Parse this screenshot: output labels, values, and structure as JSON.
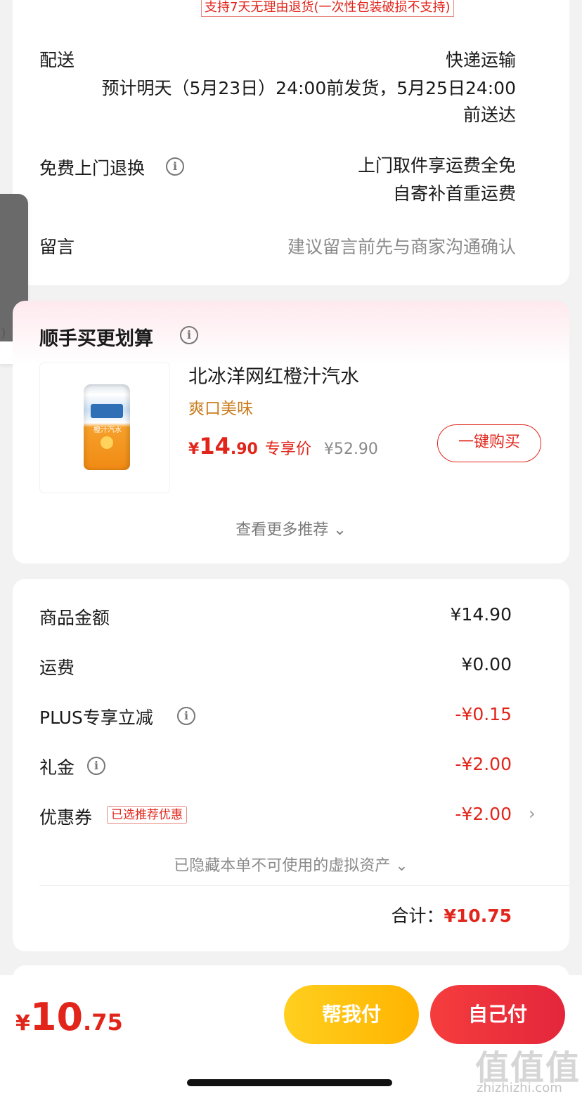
{
  "notice": {
    "text": "支持7天无理由退货(一次性包装破损不支持)"
  },
  "delivery": {
    "label": "配送",
    "method": "快递运输",
    "eta_line1": "预计明天（5月23日）24:00前发货，5月25日24:00",
    "eta_line2": "前送达"
  },
  "returns": {
    "label": "免费上门退换",
    "value_line1": "上门取件享运费全免",
    "value_line2": "自寄补首重运费"
  },
  "message": {
    "label": "留言",
    "placeholder": "建议留言前先与商家沟通确认"
  },
  "recommend": {
    "title": "顺手买更划算",
    "product": {
      "name": "北冰洋网红橙汁汽水",
      "subtitle": "爽口美味",
      "price_symbol": "¥",
      "price_int": "14",
      "price_dec": ".90",
      "price_tag": "专享价",
      "original_price": "¥52.90",
      "can_text": "橙汁汽水"
    },
    "buy_button": "一键购买",
    "more": "查看更多推荐 ⌄"
  },
  "summary": {
    "rows": [
      {
        "label": "商品金额",
        "value": "¥14.90"
      },
      {
        "label": "运费",
        "value": "¥0.00"
      },
      {
        "label": "PLUS专享立减",
        "value": "-¥0.15"
      },
      {
        "label": "礼金",
        "value": "-¥2.00"
      },
      {
        "label": "优惠券",
        "value": "-¥2.00",
        "tag": "已选推荐优惠"
      }
    ],
    "hidden_assets": "已隐藏本单不可使用的虚拟资产 ⌄",
    "total_label": "合计：",
    "total_value": "¥10.75"
  },
  "bottom": {
    "price_symbol": "¥",
    "price_int": "10",
    "price_dec": ".75",
    "help_pay": "帮我付",
    "self_pay": "自己付"
  },
  "watermark": {
    "text": "值值值",
    "url": "zhizhizhi.com"
  },
  "icons": {
    "info": "info-circle-icon",
    "chevron": "chevron-right-icon"
  },
  "colors": {
    "accent_red": "#e1251b",
    "orange": "#c97b1a",
    "yellow_btn": "#ffc20e",
    "red_btn": "#f0303c"
  }
}
